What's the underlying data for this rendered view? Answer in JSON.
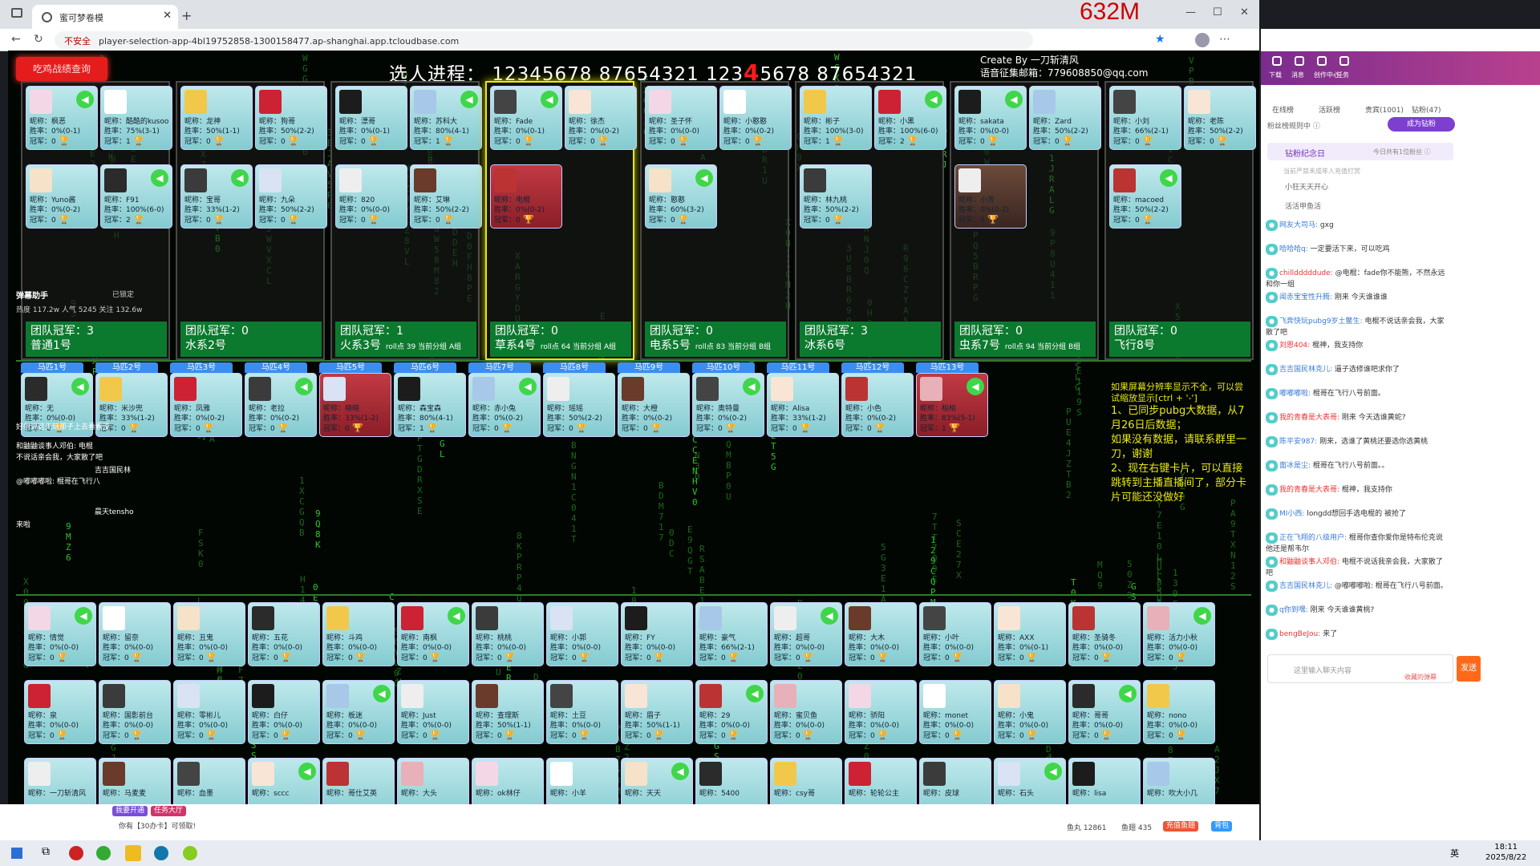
{
  "browser": {
    "tab_title": "蜜可梦卷模",
    "insecure": "不安全",
    "url": "player-selection-app-4bl19752858-1300158477.ap-shanghai.app.tcloudbase.com",
    "memory": "632M"
  },
  "header": {
    "query_button": "吃鸡战绩查询",
    "progress_label": "选人进程：",
    "progress_pre": "12345678 87654321 123",
    "progress_highlight": "4",
    "progress_post": "5678 87654321",
    "credit_line1": "Create By 一刀斩清风",
    "credit_line2": "语音征集邮箱：779608850@qq.com"
  },
  "teams": [
    {
      "name": "普通1号",
      "champ": "团队冠军：3",
      "extra": ""
    },
    {
      "name": "水系2号",
      "champ": "团队冠军：0",
      "extra": ""
    },
    {
      "name": "火系3号",
      "champ": "团队冠军：1",
      "extra": "roll点 39 当前分组 A组"
    },
    {
      "name": "草系4号",
      "champ": "团队冠军：0",
      "extra": "roll点 64 当前分组 A组"
    },
    {
      "name": "电系5号",
      "champ": "团队冠军：0",
      "extra": "roll点 83 当前分组 B组"
    },
    {
      "name": "冰系6号",
      "champ": "团队冠军：3",
      "extra": ""
    },
    {
      "name": "虫系7号",
      "champ": "团队冠军：0",
      "extra": "roll点 94 当前分组 B组"
    },
    {
      "name": "飞行8号",
      "champ": "团队冠军：0",
      "extra": ""
    }
  ],
  "team_cards": [
    [
      {
        "n": "昵称：枫恶",
        "w": "胜率：0%(0-1)",
        "c": "冠军：0"
      },
      {
        "n": "昵称：酷酷的kusoo",
        "w": "胜率：75%(3-1)",
        "c": "冠军：1"
      },
      {
        "n": "昵称：Yuno酱",
        "w": "胜率：0%(0-2)",
        "c": "冠军：0"
      },
      {
        "n": "昵称：F91",
        "w": "胜率：100%(6-0)",
        "c": "冠军：2"
      }
    ],
    [
      {
        "n": "昵称：龙神",
        "w": "胜率：50%(1-1)",
        "c": "冠军：0"
      },
      {
        "n": "昵称：狗哥",
        "w": "胜率：50%(2-2)",
        "c": "冠军：0"
      },
      {
        "n": "昵称：宝哥",
        "w": "胜率：33%(1-2)",
        "c": "冠军：0"
      },
      {
        "n": "昵称：九朵",
        "w": "胜率：50%(2-2)",
        "c": "冠军：0"
      }
    ],
    [
      {
        "n": "昵称：漂哥",
        "w": "胜率：0%(0-1)",
        "c": "冠军：0"
      },
      {
        "n": "昵称：苏科大",
        "w": "胜率：80%(4-1)",
        "c": "冠军：1"
      },
      {
        "n": "昵称：820",
        "w": "胜率：0%(0-0)",
        "c": "冠军：0"
      },
      {
        "n": "昵称：艾琳",
        "w": "胜率：50%(2-2)",
        "c": "冠军：0"
      }
    ],
    [
      {
        "n": "昵称：Fade",
        "w": "胜率：0%(0-1)",
        "c": "冠军：0"
      },
      {
        "n": "昵称：徐杰",
        "w": "胜率：0%(0-2)",
        "c": "冠军：0"
      },
      {
        "n": "昵称：电棍",
        "w": "胜率：0%(0-2)",
        "c": "冠军：0"
      }
    ],
    [
      {
        "n": "昵称：圣子怀",
        "w": "胜率：0%(0-0)",
        "c": "冠军：0"
      },
      {
        "n": "昵称：小憨憨",
        "w": "胜率：0%(0-2)",
        "c": "冠军：0"
      },
      {
        "n": "昵称：憨憨",
        "w": "胜率：60%(3-2)",
        "c": "冠军：0"
      }
    ],
    [
      {
        "n": "昵称：彬子",
        "w": "胜率：100%(3-0)",
        "c": "冠军：1"
      },
      {
        "n": "昵称：小黑",
        "w": "胜率：100%(6-0)",
        "c": "冠军：2"
      },
      {
        "n": "昵称：林九桃",
        "w": "胜率：50%(2-2)",
        "c": "冠军：0"
      }
    ],
    [
      {
        "n": "昵称：sakata",
        "w": "胜率：0%(0-0)",
        "c": "冠军：0"
      },
      {
        "n": "昵称：Zard",
        "w": "胜率：50%(2-2)",
        "c": "冠军：0"
      },
      {
        "n": "昵称：小芳",
        "w": "胜率：0%(0-2)",
        "c": "冠军：0"
      }
    ],
    [
      {
        "n": "昵称：小刘",
        "w": "胜率：66%(2-1)",
        "c": "冠军：0"
      },
      {
        "n": "昵称：老陈",
        "w": "胜率：50%(2-2)",
        "c": "冠军：0"
      },
      {
        "n": "昵称：macoed",
        "w": "胜率：50%(2-2)",
        "c": "冠军：0"
      }
    ]
  ],
  "horse_tabs": [
    "马匹1号",
    "马匹2号",
    "马匹3号",
    "马匹4号",
    "马匹5号",
    "马匹6号",
    "马匹7号",
    "马匹8号",
    "马匹9号",
    "马匹10号",
    "马匹11号",
    "马匹12号",
    "马匹13号"
  ],
  "horse_cards": [
    {
      "n": "昵称：无",
      "w": "胜率：0%(0-0)",
      "c": "冠军：0"
    },
    {
      "n": "昵称：米沙兜",
      "w": "胜率：33%(1-2)",
      "c": "冠军：0"
    },
    {
      "n": "昵称：凤雅",
      "w": "胜率：0%(0-2)",
      "c": "冠军：0"
    },
    {
      "n": "昵称：老拉",
      "w": "胜率：0%(0-2)",
      "c": "冠军：0"
    },
    {
      "n": "昵称：晓晓",
      "w": "胜率：33%(1-2)",
      "c": "冠军：0"
    },
    {
      "n": "昵称：森宝森",
      "w": "胜率：80%(4-1)",
      "c": "冠军：1"
    },
    {
      "n": "昵称：赤小兔",
      "w": "胜率：0%(0-2)",
      "c": "冠军：0"
    },
    {
      "n": "昵称：瑶瑶",
      "w": "胜率：50%(2-2)",
      "c": "冠军：0"
    },
    {
      "n": "昵称：大橙",
      "w": "胜率：0%(0-2)",
      "c": "冠军：0"
    },
    {
      "n": "昵称：奥特曼",
      "w": "胜率：0%(0-2)",
      "c": "冠军：0"
    },
    {
      "n": "昵称：Alisa",
      "w": "胜率：33%(1-2)",
      "c": "冠军：0"
    },
    {
      "n": "昵称：小色",
      "w": "胜率：0%(0-2)",
      "c": "冠军：0"
    },
    {
      "n": "昵称：柏柏",
      "w": "胜率：83%(5-1)",
      "c": "冠军：1"
    }
  ],
  "pool_row1": [
    "情觉",
    "留奈",
    "丑鬼",
    "五花",
    "斗鸡",
    "南枫",
    "桃桃",
    "小郭",
    "FY",
    "豪气",
    "超哥",
    "大木",
    "小叶",
    "AXX",
    "圣骑冬",
    "活力小秋"
  ],
  "pool_row2": [
    "泉",
    "国影前台",
    "零彬儿",
    "白仔",
    "板迷",
    "Just",
    "查理斯",
    "土豆",
    "眉子",
    "29",
    "蜜贝鱼",
    "骄阳",
    "monet",
    "小鬼",
    "哥哥",
    "nono"
  ],
  "pool_row3": [
    "一刀斩清风",
    "马麦麦",
    "血墨",
    "sccc",
    "哥仕艾英",
    "大头",
    "ok林仔",
    "小羊",
    "天天",
    "5400",
    "csy哥",
    "轮轮公主",
    "皮球",
    "石头",
    "lisa",
    "吹大小几"
  ],
  "pool_rate1": [
    "胜率：0%(0-0)",
    "胜率：0%(0-0)",
    "胜率：0%(0-0)",
    "胜率：0%(0-0)",
    "胜率：0%(0-0)",
    "胜率：0%(0-0)",
    "胜率：0%(0-0)",
    "胜率：0%(0-0)",
    "胜率：0%(0-0)",
    "胜率：66%(2-1)",
    "胜率：0%(0-0)",
    "胜率：0%(0-0)",
    "胜率：0%(0-0)",
    "胜率：0%(0-1)",
    "胜率：0%(0-0)",
    "胜率：0%(0-0)"
  ],
  "pool_rate2": [
    "胜率：0%(0-0)",
    "胜率：0%(0-0)",
    "胜率：0%(0-0)",
    "胜率：0%(0-0)",
    "胜率：0%(0-0)",
    "胜率：0%(0-0)",
    "胜率：50%(1-1)",
    "胜率：0%(0-0)",
    "胜率：50%(1-1)",
    "胜率：0%(0-0)",
    "胜率：0%(0-0)",
    "胜率：0%(0-0)",
    "胜率：0%(0-0)",
    "胜率：0%(0-0)",
    "胜率：0%(0-0)",
    "胜率：0%(0-0)"
  ],
  "info_panel": {
    "note": "如果屏幕分辨率显示不全，可以尝试缩放显示[ctrl + '-']",
    "p1": "1、已同步pubg大数据，从7月26日后数据；",
    "p2": "如果没有数据，请联系群里一刀，谢谢",
    "p3": "2、现在右键卡片，可以直接跳转到主播直播间了，部分卡片可能还没做好"
  },
  "overlay": {
    "title": "弹幕助手",
    "locked": "已锁定",
    "stats": "热度 117.2w  人气 5245  关注 132.6w",
    "l1": "好尔说这天玩那子上去看看没",
    "l2": "和鼬鼬谈事人邓伯: 电棍",
    "l3": "不说话亲会我，大家散了吧",
    "l4": "吉吉国民林",
    "l5": "@嘟嘟嘟啦: 棍哥在飞行八",
    "l6": "晨天tensho",
    "l7": "来啦"
  },
  "bottom_strip": {
    "left1": "我要开通",
    "left2": "任务大厅",
    "notice": "你有【30办卡】可领取!",
    "fishball": "鱼丸 12861",
    "fishwing": "鱼翅 435",
    "recharge": "充值鱼翅",
    "pack": "背包"
  },
  "sidebar": {
    "nav": [
      "下载",
      "消息",
      "创作中心",
      "任务"
    ],
    "tabs": [
      "在线榜",
      "活跃榜",
      "贵宾(1001)",
      "钻粉(47)"
    ],
    "fans_note": "粉丝榜规则中 ⓘ",
    "memorial": "钻粉纪念日",
    "memorial_right": "今日共有1位粉丝 ⓘ",
    "hint": "当前严禁未成年人充值打赏",
    "rank": [
      "小狂天天开心",
      "活活甲鱼活"
    ],
    "chat": [
      {
        "name": "网友大司马:",
        "msg": "gxg"
      },
      {
        "name": "哈哈哈q:",
        "msg": "一定要活下来，可以吃鸡"
      },
      {
        "name": "chilldddddude:",
        "msg": "@电棍：fade你不能熊，不然永远和你一组"
      },
      {
        "name": "闻赤宝宝性升腾:",
        "msg": "刚来 今天谁谁谁"
      },
      {
        "name": "飞奔快玩pubg9岁土鳖生:",
        "msg": "电棍不说话亲会我，大家散了吧"
      },
      {
        "name": "刘恩404:",
        "msg": "棍神，我支持你"
      },
      {
        "name": "吉吉国民林克儿:",
        "msg": "逼子选修谁吧求你了"
      },
      {
        "name": "嘟嘟嘟啦:",
        "msg": "棍哥在飞行八号前面。"
      },
      {
        "name": "我的青春是大表哥:",
        "msg": "刚来 今天选谁黄蛇?"
      },
      {
        "name": "陈平安987:",
        "msg": "刚来，选谁了黄桃还要选你选黄桃"
      },
      {
        "name": "面冰是尘:",
        "msg": "棍哥在飞行八号前面。。"
      },
      {
        "name": "我的青春是大表哥:",
        "msg": "棍神，我支持你"
      },
      {
        "name": "MI小西:",
        "msg": "longdd想回手选电棍的 被抢了"
      },
      {
        "name": "正在飞翔的八级用户:",
        "msg": "棍哥你查你爱你是特布伦克说他还是帮韦尔"
      },
      {
        "name": "和鼬鼬谈事人邓伯:",
        "msg": "电棍不说话我亲会我，大家散了吧"
      },
      {
        "name": "吉吉国民林克儿:",
        "msg": "@嘟嘟嘟啦: 棍哥在飞行八号前面。"
      },
      {
        "name": "q你到嘿:",
        "msg": "刚来 今天谁谁黄桃?"
      },
      {
        "name": "bengBeJou:",
        "msg": "来了"
      }
    ],
    "input_placeholder": "这里输入聊天内容",
    "send": "发送",
    "input_right": "收藏的弹幕"
  },
  "taskbar": {
    "ime": "英",
    "time": "18:11",
    "date": "2025/8/22"
  }
}
